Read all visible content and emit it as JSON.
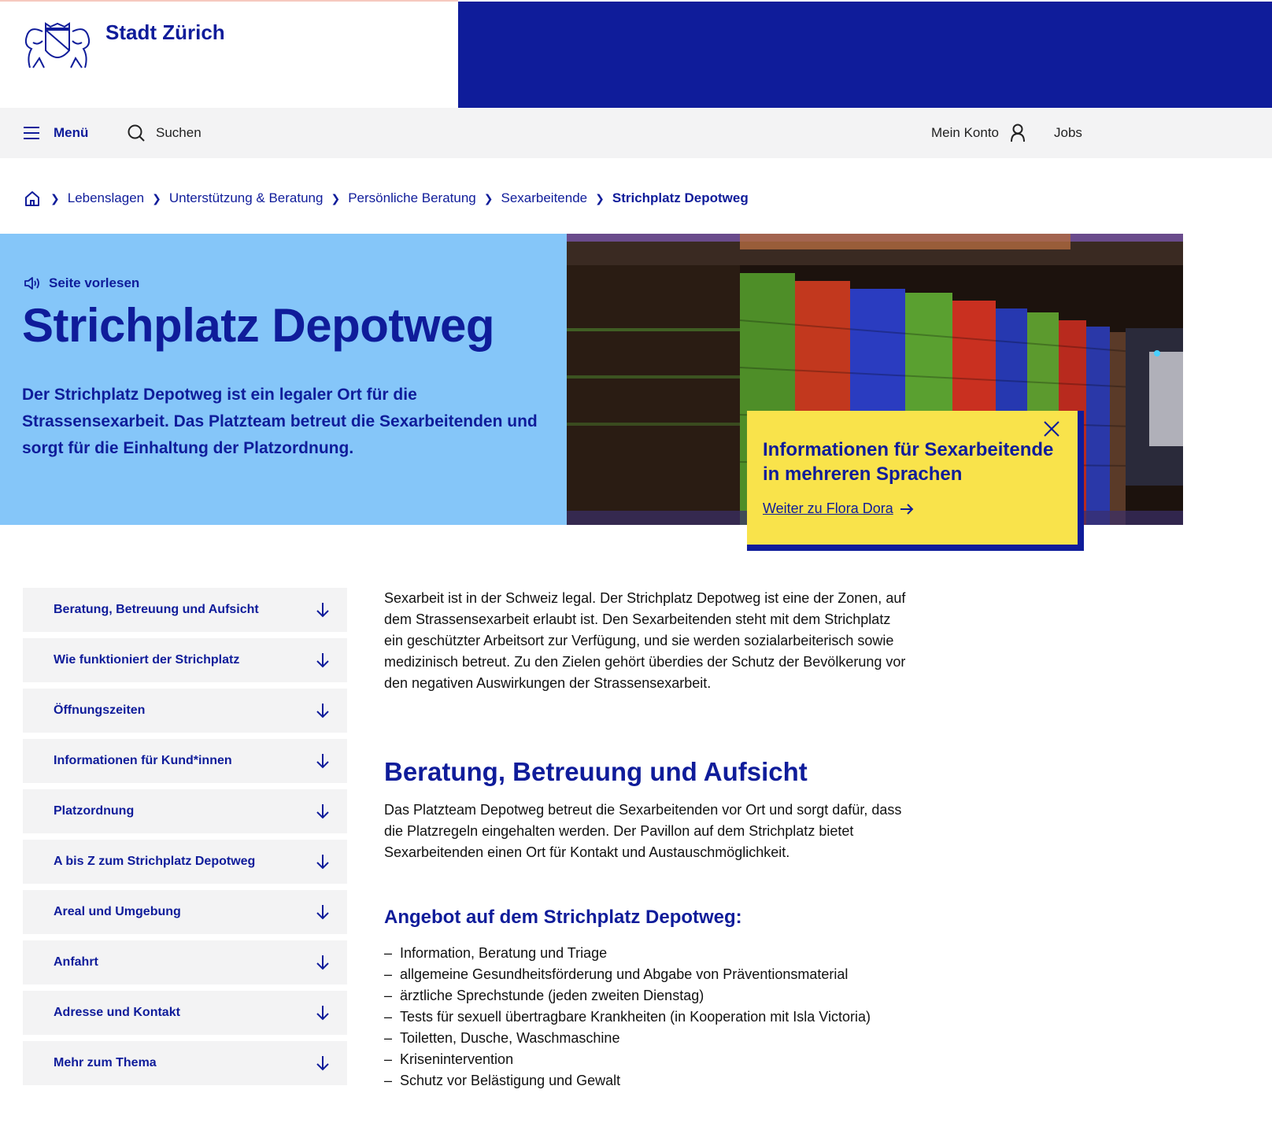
{
  "header": {
    "brand": "Stadt Zürich"
  },
  "nav": {
    "menu_label": "Menü",
    "search_label": "Suchen",
    "account_label": "Mein Konto",
    "jobs_label": "Jobs"
  },
  "breadcrumb": {
    "items": [
      "Lebenslagen",
      "Unterstützung & Beratung",
      "Persönliche Beratung",
      "Sexarbeitende"
    ],
    "current": "Strichplatz Depotweg"
  },
  "hero": {
    "read_aloud": "Seite vorlesen",
    "title": "Strichplatz Depotweg",
    "lead": "Der Strichplatz Depotweg ist ein legaler Ort für die Strassensexarbeit. Das Platzteam betreut die Sexarbeitenden und sorgt für die Einhaltung der Platzordnung."
  },
  "infobox": {
    "title": "Informationen für Sexarbeitende in mehreren Sprachen",
    "link": "Weiter zu Flora Dora"
  },
  "sidebar": {
    "items": [
      "Beratung, Betreuung und Aufsicht",
      "Wie funktioniert der Strichplatz",
      "Öffnungszeiten",
      "Informationen für Kund*innen",
      "Platzordnung",
      "A bis Z zum Strichplatz Depotweg",
      "Areal und Umgebung",
      "Anfahrt",
      "Adresse und Kontakt",
      "Mehr zum Thema"
    ]
  },
  "main": {
    "intro": "Sexarbeit ist in der Schweiz legal. Der Strichplatz Depotweg ist eine der Zonen, auf dem Strassensexarbeit erlaubt ist. Den Sexarbeitenden steht mit dem Strichplatz ein geschützter Arbeitsort zur Verfügung, und sie werden sozialarbeiterisch sowie medizinisch betreut.  Zu den Zielen gehört überdies der Schutz der Bevölkerung vor den negativen Auswirkungen der Strassensexarbeit.",
    "section_title": "Beratung, Betreuung und Aufsicht",
    "section_text": "Das Platzteam Depotweg betreut die Sexarbeitenden vor Ort und sorgt dafür, dass die Platzregeln eingehalten werden. Der Pavillon auf dem Strichplatz bietet Sexarbeitenden einen Ort für Kontakt und Austauschmöglichkeit.",
    "offer_title": "Angebot auf dem Strichplatz Depotweg:",
    "offers": [
      "Information, Beratung und Triage",
      "allgemeine Gesundheitsförderung und Abgabe von Präventionsmaterial",
      "ärztliche Sprechstunde (jeden zweiten Dienstag)",
      "Tests für sexuell übertragbare Krankheiten (in Kooperation mit Isla Victoria)",
      "Toiletten, Dusche, Waschmaschine",
      "Krisenintervention",
      "Schutz vor Belästigung und Gewalt"
    ]
  },
  "colors": {
    "brand_blue": "#0f1c9a",
    "hero_light_blue": "#85c6f9",
    "infobox_yellow": "#f9e34b",
    "nav_gray": "#f3f3f4"
  },
  "icons": [
    "coat-of-arms-logo",
    "hamburger-icon",
    "search-icon",
    "user-icon",
    "home-icon",
    "chevron-right-icon",
    "speaker-icon",
    "close-icon",
    "arrow-right-icon",
    "arrow-down-icon"
  ]
}
